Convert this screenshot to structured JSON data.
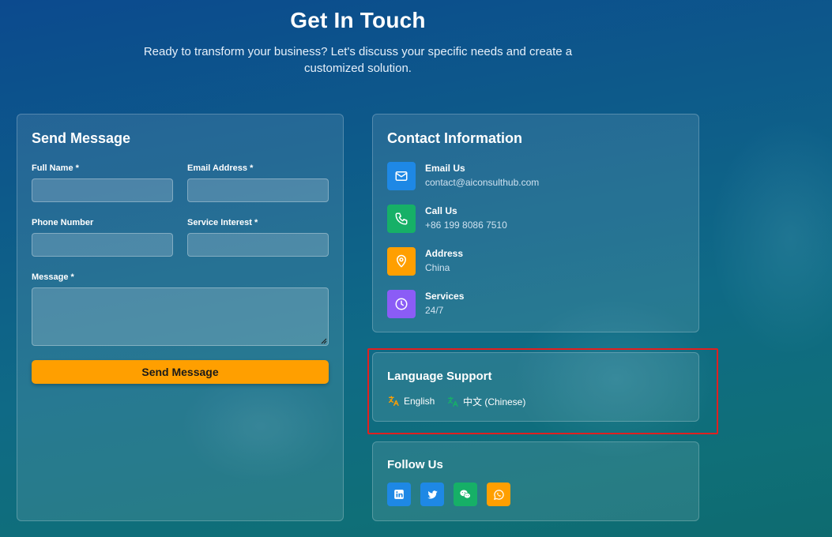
{
  "header": {
    "title": "Get In Touch",
    "subtitle": "Ready to transform your business? Let's discuss your specific needs and create a customized solution."
  },
  "form": {
    "title": "Send Message",
    "full_name_label": "Full Name *",
    "email_label": "Email Address *",
    "phone_label": "Phone Number",
    "service_label": "Service Interest *",
    "message_label": "Message *",
    "submit_label": "Send Message"
  },
  "contact": {
    "title": "Contact Information",
    "items": [
      {
        "label": "Email Us",
        "value": "contact@aiconsulthub.com",
        "icon": "mail-icon",
        "color": "#1e88e5"
      },
      {
        "label": "Call Us",
        "value": "+86 199 8086 7510",
        "icon": "phone-icon",
        "color": "#16b067"
      },
      {
        "label": "Address",
        "value": "China",
        "icon": "map-pin-icon",
        "color": "#ff9f00"
      },
      {
        "label": "Services",
        "value": "24/7",
        "icon": "clock-icon",
        "color": "#8b5cf6"
      }
    ]
  },
  "language": {
    "title": "Language Support",
    "items": [
      {
        "label": "English",
        "icon": "translate-icon",
        "color": "#ff9f00"
      },
      {
        "label": "中文 (Chinese)",
        "icon": "translate-icon",
        "color": "#16b067"
      }
    ]
  },
  "follow": {
    "title": "Follow Us",
    "items": [
      {
        "icon": "linkedin-icon",
        "color": "#1e88e5"
      },
      {
        "icon": "twitter-icon",
        "color": "#1e88e5"
      },
      {
        "icon": "wechat-icon",
        "color": "#16b067"
      },
      {
        "icon": "whatsapp-icon",
        "color": "#ff9f00"
      }
    ]
  },
  "colors": {
    "accent": "#ff9f00",
    "highlight": "#e02020"
  }
}
